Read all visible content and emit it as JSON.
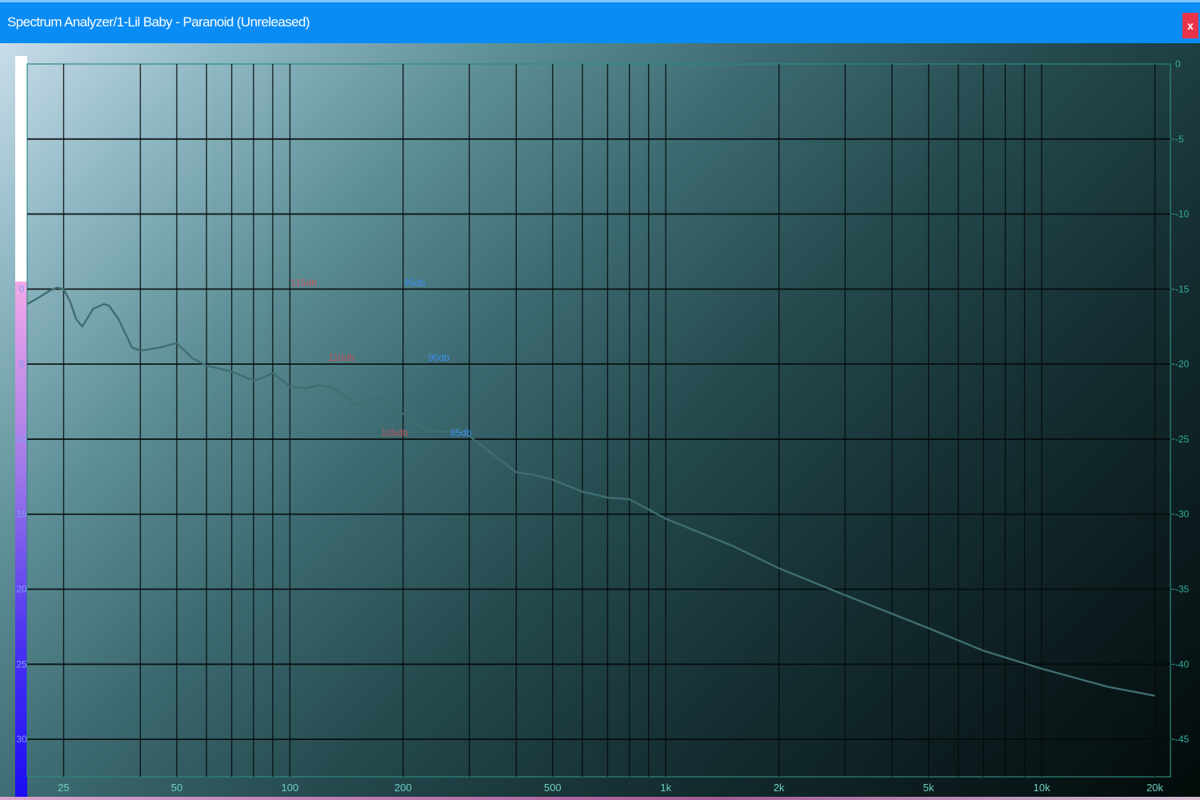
{
  "window": {
    "title": "Spectrum Analyzer/1-Lil Baby - Paranoid (Unreleased)",
    "close_label": "x"
  },
  "colors": {
    "titlebar": "#0a8cf5",
    "close_button": "#e8334a",
    "grid": "#050a0a",
    "curve": "#3f6e70",
    "frame": "#2f8a80",
    "threshold_red": "#c0545e",
    "threshold_blue": "#3b8ef0"
  },
  "chart_data": {
    "type": "line",
    "x_scale": "log",
    "xlim": [
      20,
      22000
    ],
    "x_ticks": [
      {
        "value": 25,
        "label": "25"
      },
      {
        "value": 50,
        "label": "50"
      },
      {
        "value": 100,
        "label": "100"
      },
      {
        "value": 200,
        "label": "200"
      },
      {
        "value": 500,
        "label": "500"
      },
      {
        "value": 1000,
        "label": "1k"
      },
      {
        "value": 2000,
        "label": "2k"
      },
      {
        "value": 5000,
        "label": "5k"
      },
      {
        "value": 10000,
        "label": "10k"
      },
      {
        "value": 20000,
        "label": "20k"
      }
    ],
    "x_gridlines": [
      25,
      40,
      50,
      60,
      70,
      80,
      90,
      100,
      200,
      300,
      400,
      500,
      600,
      700,
      800,
      900,
      1000,
      2000,
      3000,
      4000,
      5000,
      6000,
      7000,
      8000,
      9000,
      10000,
      20000
    ],
    "ylim": [
      0,
      -47.5
    ],
    "right_axis_ticks": [
      "0",
      "-5",
      "-10",
      "-15",
      "-20",
      "-25",
      "-30",
      "-35",
      "-40",
      "-45"
    ],
    "right_axis_values": [
      0,
      -5,
      -10,
      -15,
      -20,
      -25,
      -30,
      -35,
      -40,
      -45
    ],
    "left_axis_ticks": [
      "0",
      "5",
      "10",
      "15",
      "20",
      "25",
      "30"
    ],
    "left_axis_values": [
      0,
      -5,
      -10,
      -15,
      -20,
      -25,
      -30
    ],
    "left_axis_offset_db": -15,
    "annotations": [
      {
        "label": "115db",
        "x": 100,
        "y": -15,
        "color": "red"
      },
      {
        "label": "95db",
        "x": 200,
        "y": -15,
        "color": "blue"
      },
      {
        "label": "110db",
        "x": 126,
        "y": -20,
        "color": "red"
      },
      {
        "label": "90db",
        "x": 232,
        "y": -20,
        "color": "blue"
      },
      {
        "label": "105db",
        "x": 174,
        "y": -25,
        "color": "red"
      },
      {
        "label": "85db",
        "x": 266,
        "y": -25,
        "color": "blue"
      }
    ],
    "series": [
      {
        "x": [
          20,
          21,
          22,
          23,
          24,
          25,
          26,
          27,
          28,
          30,
          32,
          33,
          35,
          38,
          40,
          45,
          50,
          55,
          60,
          70,
          80,
          85,
          90,
          100,
          110,
          120,
          130,
          140,
          150,
          170,
          180,
          200,
          230,
          250,
          280,
          300,
          400,
          450,
          500,
          600,
          700,
          800,
          1000,
          1500,
          2000,
          3000,
          5000,
          7000,
          10000,
          15000,
          20000
        ],
        "y": [
          -16.0,
          -15.7,
          -15.4,
          -15.1,
          -14.9,
          -15.0,
          -15.8,
          -17.0,
          -17.5,
          -16.3,
          -16.0,
          -16.1,
          -17.0,
          -18.9,
          -19.1,
          -18.9,
          -18.6,
          -19.6,
          -20.1,
          -20.5,
          -21.1,
          -20.9,
          -20.6,
          -21.5,
          -21.6,
          -21.4,
          -21.6,
          -22.1,
          -22.7,
          -22.3,
          -22.5,
          -23.3,
          -24.4,
          -24.5,
          -24.5,
          -24.8,
          -27.2,
          -27.4,
          -27.7,
          -28.5,
          -28.9,
          -29.0,
          -30.3,
          -32.1,
          -33.6,
          -35.4,
          -37.6,
          -39.1,
          -40.3,
          -41.5,
          -42.1
        ]
      }
    ]
  }
}
